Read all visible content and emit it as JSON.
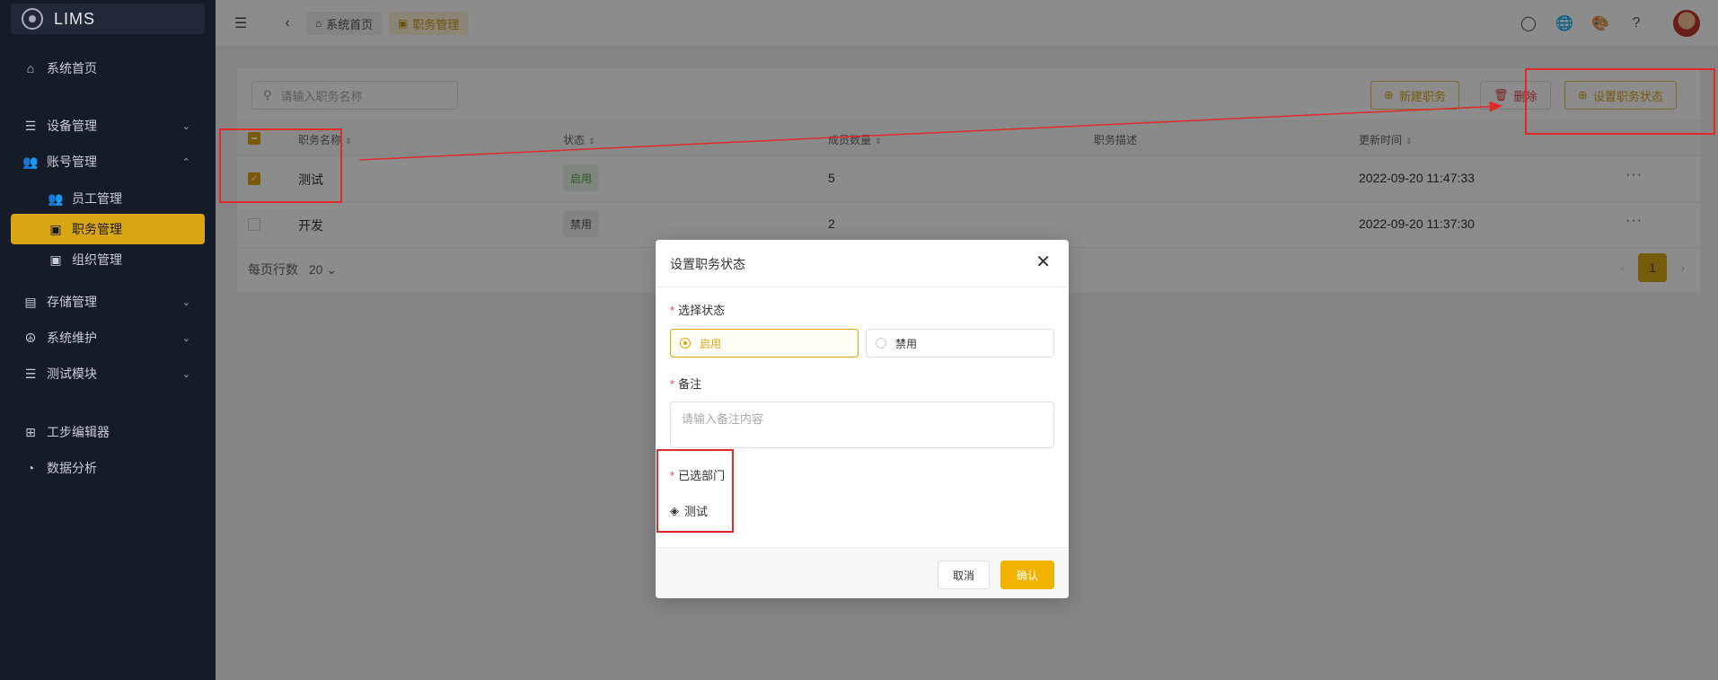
{
  "sidebar": {
    "logo": "LIMS",
    "items": [
      {
        "label": "系统首页"
      },
      {
        "label": "设备管理"
      },
      {
        "label": "账号管理"
      },
      {
        "label": "员工管理"
      },
      {
        "label": "职务管理"
      },
      {
        "label": "组织管理"
      },
      {
        "label": "存储管理"
      },
      {
        "label": "系统维护"
      },
      {
        "label": "测试模块"
      },
      {
        "label": "工步编辑器"
      },
      {
        "label": "数据分析"
      }
    ]
  },
  "header": {
    "breadcrumbs": [
      "系统首页",
      "职务管理"
    ]
  },
  "toolbar": {
    "search_placeholder": "请输入职务名称",
    "new_label": "新建职务",
    "delete_label": "删除",
    "set_status_label": "设置职务状态"
  },
  "table": {
    "columns": [
      "职务名称",
      "状态",
      "成员数量",
      "职务描述",
      "更新时间"
    ],
    "rows": [
      {
        "name": "测试",
        "status": "启用",
        "members": "5",
        "desc": "",
        "updated": "2022-09-20 11:47:33",
        "more": "···"
      },
      {
        "name": "开发",
        "status": "禁用",
        "members": "2",
        "desc": "",
        "updated": "2022-09-20 11:37:30",
        "more": "···"
      }
    ],
    "page_size_label": "每页行数",
    "page_size": "20",
    "current_page": "1"
  },
  "modal": {
    "title": "设置职务状态",
    "status_label": "选择状态",
    "status_options": [
      "启用",
      "禁用"
    ],
    "selected_status": "启用",
    "remark_label": "备注",
    "remark_placeholder": "请输入备注内容",
    "dept_label": "已选部门",
    "selected_dept": "测试",
    "cancel_label": "取消",
    "confirm_label": "确认"
  },
  "colors": {
    "accent": "#d9a616",
    "sidebar_bg": "#161b28",
    "annotation": "#e02a2a"
  }
}
